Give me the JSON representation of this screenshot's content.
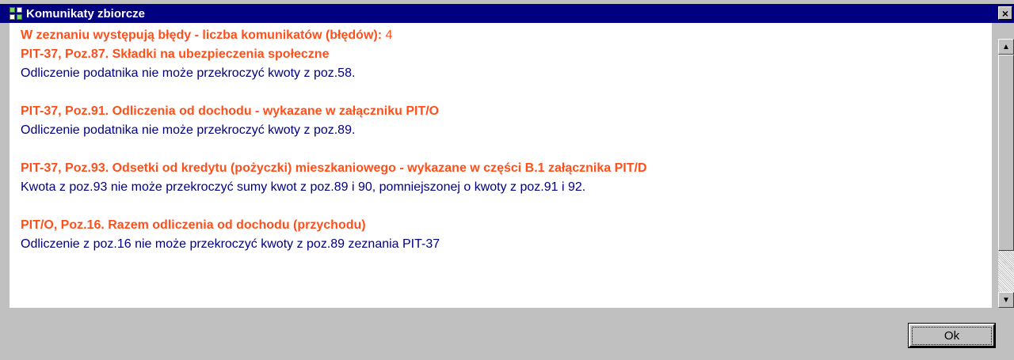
{
  "window": {
    "title": "Komunikaty zbiorcze",
    "app_icon": "grid-app-icon",
    "close_label": "×"
  },
  "summary": {
    "label": "W zeznaniu występują błędy - liczba komunikatów (błędów):",
    "count": "4"
  },
  "messages": [
    {
      "title": "PIT-37, Poz.87. Składki na ubezpieczenia społeczne",
      "text": "Odliczenie podatnika nie może przekroczyć kwoty z poz.58."
    },
    {
      "title": "PIT-37, Poz.91. Odliczenia od dochodu - wykazane w załączniku PIT/O",
      "text": "Odliczenie podatnika nie może przekroczyć kwoty z poz.89."
    },
    {
      "title": "PIT-37, Poz.93. Odsetki od kredytu (pożyczki) mieszkaniowego - wykazane w części B.1 załącznika PIT/D",
      "text": "Kwota z poz.93 nie może przekroczyć sumy kwot z poz.89 i 90, pomniejszonej o kwoty z poz.91 i 92."
    },
    {
      "title": "PIT/O, Poz.16. Razem odliczenia od dochodu (przychodu)",
      "text": "Odliczenie z poz.16 nie może przekroczyć kwoty z poz.89 zeznania PIT-37"
    }
  ],
  "scrollbar": {
    "up_icon": "arrow-up-icon",
    "down_icon": "arrow-down-icon",
    "up_glyph": "▲",
    "down_glyph": "▼"
  },
  "buttons": {
    "ok_label": "Ok"
  },
  "colors": {
    "titlebar": "#000080",
    "error_title": "#ff4f1a",
    "message_text": "#000080",
    "background": "#c0c0c0"
  }
}
